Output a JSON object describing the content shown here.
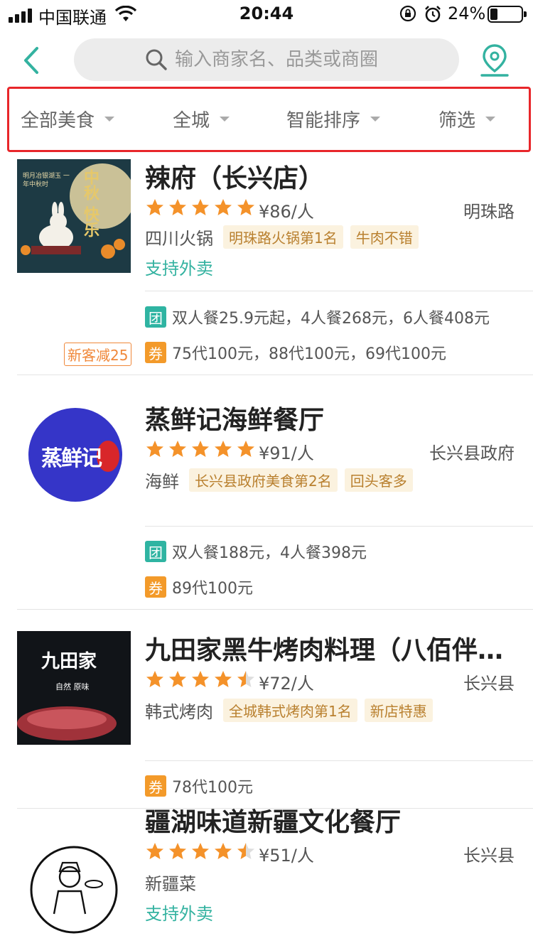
{
  "status_bar": {
    "carrier": "中国联通",
    "time": "20:44",
    "battery_percent": "24%",
    "battery_level": 0.24
  },
  "search": {
    "placeholder": "输入商家名、品类或商圈"
  },
  "filters": [
    {
      "label": "全部美食"
    },
    {
      "label": "全城"
    },
    {
      "label": "智能排序"
    },
    {
      "label": "筛选"
    }
  ],
  "shops": [
    {
      "name": "辣府（长兴店）",
      "rating": 5,
      "price": "¥86/人",
      "area": "明珠路",
      "category": "四川火锅",
      "tags": [
        "明珠路火锅第1名",
        "牛肉不错"
      ],
      "delivery": "支持外卖",
      "tuan_badge": "团",
      "tuan_text": "双人餐25.9元起，4人餐268元，6人餐408元",
      "quan_badge": "券",
      "quan_text": "75代100元，88代100元，69代100元",
      "new_customer": "新客减25",
      "thumb_text_1": "中秋",
      "thumb_text_2": "快乐",
      "thumb_caption": "明月冶银湖玉 一年中秋时"
    },
    {
      "name": "蒸鲜记海鲜餐厅",
      "rating": 5,
      "price": "¥91/人",
      "area": "长兴县政府",
      "category": "海鲜",
      "tags": [
        "长兴县政府美食第2名",
        "回头客多"
      ],
      "tuan_badge": "团",
      "tuan_text": "双人餐188元，4人餐398元",
      "quan_badge": "券",
      "quan_text": "89代100元",
      "logo_text": "蒸鲜记"
    },
    {
      "name": "九田家黑牛烤肉料理（八佰伴…",
      "rating": 4.5,
      "price": "¥72/人",
      "area": "长兴县",
      "category": "韩式烤肉",
      "tags": [
        "全城韩式烤肉第1名",
        "新店特惠"
      ],
      "quan_badge": "券",
      "quan_text": "78代100元",
      "thumb_text": "九田家",
      "thumb_caption": "自然 原味"
    },
    {
      "name": "疆湖味道新疆文化餐厅",
      "rating": 4.5,
      "price": "¥51/人",
      "area": "长兴县",
      "category": "新疆菜",
      "tags": [],
      "delivery": "支持外卖"
    }
  ],
  "colors": {
    "accent_teal": "#33b2a0",
    "star_orange": "#f4922a",
    "highlight_red": "#e8262a"
  }
}
